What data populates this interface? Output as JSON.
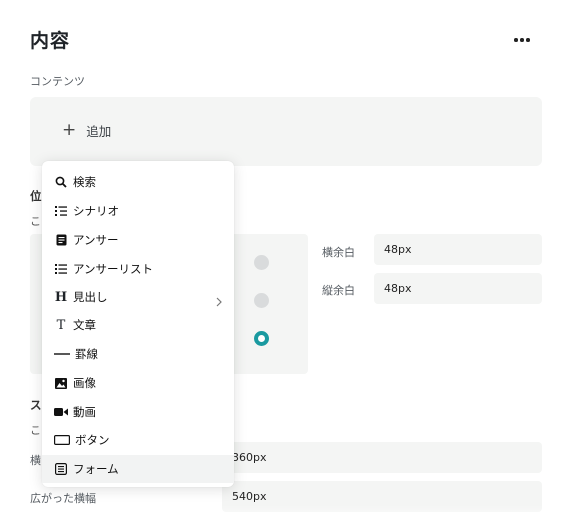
{
  "header": {
    "title": "内容",
    "more_icon": "more-horizontal-icon"
  },
  "contents": {
    "section_label": "コンテンツ",
    "add_label": "追加",
    "add_icon": "plus-icon"
  },
  "position": {
    "label_fragment": "位",
    "desc_fragment": "こ",
    "radios": [
      {
        "selected": false
      },
      {
        "selected": false
      },
      {
        "selected": true
      }
    ],
    "padding_x_label": "横余白",
    "padding_x_value": "48px",
    "padding_y_label": "縦余白",
    "padding_y_value": "48px"
  },
  "size": {
    "label_fragment": "ス",
    "desc_fragment": "こ",
    "width_label_fragment": "横",
    "width_value": "360px",
    "wide_width_label": "広がった横幅",
    "wide_width_value": "540px"
  },
  "menu": {
    "items": [
      {
        "label": "検索",
        "icon": "search-icon"
      },
      {
        "label": "シナリオ",
        "icon": "scenario-list-icon"
      },
      {
        "label": "アンサー",
        "icon": "answer-doc-icon"
      },
      {
        "label": "アンサーリスト",
        "icon": "bullet-list-icon"
      },
      {
        "label": "見出し",
        "icon": "heading-icon",
        "has_submenu": true
      },
      {
        "label": "文章",
        "icon": "text-icon"
      },
      {
        "label": "罫線",
        "icon": "divider-line-icon"
      },
      {
        "label": "画像",
        "icon": "image-icon"
      },
      {
        "label": "動画",
        "icon": "video-icon"
      },
      {
        "label": "ボタン",
        "icon": "button-icon"
      },
      {
        "label": "フォーム",
        "icon": "form-icon",
        "hovered": true
      }
    ]
  },
  "colors": {
    "accent": "#1a9aa0",
    "panel_bg": "#f4f5f4"
  }
}
